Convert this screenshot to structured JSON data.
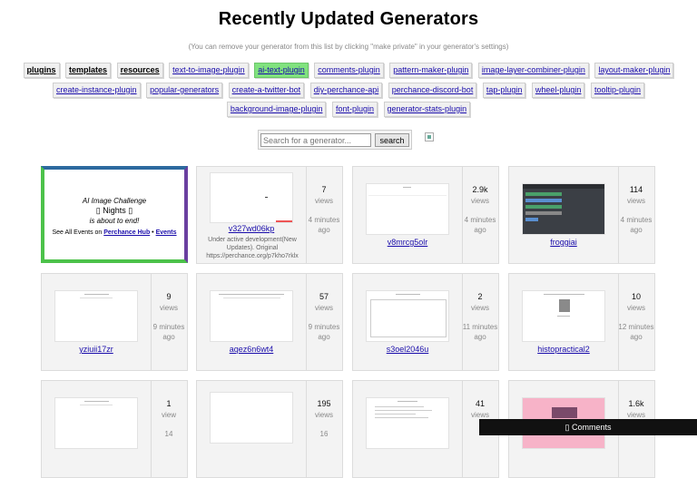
{
  "title": "Recently Updated Generators",
  "note": "(You can remove your generator from this list by clicking \"make private\" in your generator's settings)",
  "tags_row1": [
    "plugins",
    "templates",
    "resources",
    "text-to-image-plugin",
    "ai-text-plugin",
    "comments-plugin",
    "pattern-maker-plugin",
    "image-layer-combiner-plugin",
    "layout-maker-plugin"
  ],
  "tags_row2": [
    "create-instance-plugin",
    "popular-generators",
    "create-a-twitter-bot",
    "diy-perchance-api",
    "perchance-discord-bot",
    "tap-plugin",
    "wheel-plugin",
    "tooltip-plugin"
  ],
  "tags_row3": [
    "background-image-plugin",
    "font-plugin",
    "generator-stats-plugin"
  ],
  "search": {
    "placeholder": "Search for a generator...",
    "button": "search"
  },
  "promo": {
    "line1": "AI Image Challenge",
    "line2": "▯ Nights ▯",
    "line3": "is about to end!",
    "line4_prefix": "See All Events on ",
    "link1": "Perchance Hub",
    "sep": " • ",
    "link2": "Events"
  },
  "cards": [
    {
      "name": "v327wd06kp",
      "views": "7",
      "views_label": "views",
      "time": "4 minutes ago",
      "desc": "Under active development(New Updates). Original https://perchance.org/p7kho7rklx"
    },
    {
      "name": "v8mrcg5olr",
      "views": "2.9k",
      "views_label": "views",
      "time": "4 minutes ago"
    },
    {
      "name": "froggiai",
      "views": "114",
      "views_label": "views",
      "time": "4 minutes ago"
    },
    {
      "name": "yziuii17zr",
      "views": "9",
      "views_label": "views",
      "time": "9 minutes ago"
    },
    {
      "name": "aqez6n6wt4",
      "views": "57",
      "views_label": "views",
      "time": "9 minutes ago"
    },
    {
      "name": "s3oel2046u",
      "views": "2",
      "views_label": "views",
      "time": "11 minutes ago"
    },
    {
      "name": "histopractical2",
      "views": "10",
      "views_label": "views",
      "time": "12 minutes ago"
    },
    {
      "name": "",
      "views": "1",
      "views_label": "view",
      "time": "14"
    },
    {
      "name": "",
      "views": "195",
      "views_label": "views",
      "time": "16"
    },
    {
      "name": "",
      "views": "41",
      "views_label": "views",
      "time": ""
    },
    {
      "name": "",
      "views": "1.6k",
      "views_label": "views",
      "time": ""
    }
  ],
  "comments": "▯ Comments"
}
